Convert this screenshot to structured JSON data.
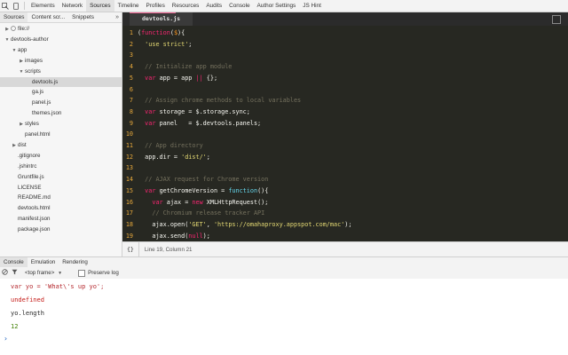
{
  "toolbar": {
    "tabs": [
      "Elements",
      "Network",
      "Sources",
      "Timeline",
      "Profiles",
      "Resources",
      "Audits",
      "Console",
      "Author Settings",
      "JS Hint"
    ],
    "active_tab": "Sources"
  },
  "navigator": {
    "tabs": [
      "Sources",
      "Content scr...",
      "Snippets"
    ],
    "more": "»",
    "tree": [
      {
        "label": "file://",
        "depth": 0,
        "arrow": "▶"
      },
      {
        "label": "devtools-author",
        "depth": 0,
        "arrow": "▼"
      },
      {
        "label": "app",
        "depth": 1,
        "arrow": "▼"
      },
      {
        "label": "images",
        "depth": 2,
        "arrow": "▶"
      },
      {
        "label": "scripts",
        "depth": 2,
        "arrow": "▼"
      },
      {
        "label": "devtools.js",
        "depth": 3,
        "arrow": "",
        "selected": true
      },
      {
        "label": "ga.js",
        "depth": 3,
        "arrow": ""
      },
      {
        "label": "panel.js",
        "depth": 3,
        "arrow": ""
      },
      {
        "label": "themes.json",
        "depth": 3,
        "arrow": ""
      },
      {
        "label": "styles",
        "depth": 2,
        "arrow": "▶"
      },
      {
        "label": "panel.html",
        "depth": 2,
        "arrow": ""
      },
      {
        "label": "dist",
        "depth": 1,
        "arrow": "▶"
      },
      {
        "label": ".gitignore",
        "depth": 1,
        "arrow": ""
      },
      {
        "label": ".jshintrc",
        "depth": 1,
        "arrow": ""
      },
      {
        "label": "Gruntfile.js",
        "depth": 1,
        "arrow": ""
      },
      {
        "label": "LICENSE",
        "depth": 1,
        "arrow": ""
      },
      {
        "label": "README.md",
        "depth": 1,
        "arrow": ""
      },
      {
        "label": "devtools.html",
        "depth": 1,
        "arrow": ""
      },
      {
        "label": "manifest.json",
        "depth": 1,
        "arrow": ""
      },
      {
        "label": "package.json",
        "depth": 1,
        "arrow": ""
      }
    ]
  },
  "editor": {
    "file_tab": "devtools.js",
    "lines": [
      {
        "n": "1",
        "tokens": [
          [
            "punc",
            "("
          ],
          [
            "keyword",
            "function"
          ],
          [
            "punc",
            "("
          ],
          [
            "param",
            "$"
          ],
          [
            "punc",
            "){"
          ]
        ]
      },
      {
        "n": "2",
        "tokens": [
          [
            "string",
            "  'use strict'"
          ],
          [
            "punc",
            ";"
          ]
        ]
      },
      {
        "n": "3",
        "tokens": []
      },
      {
        "n": "4",
        "tokens": [
          [
            "comment",
            "  // Initialize app module"
          ]
        ]
      },
      {
        "n": "5",
        "tokens": [
          [
            "keyword",
            "  var "
          ],
          [
            "plain",
            "app = app "
          ],
          [
            "keyword",
            "||"
          ],
          [
            "plain",
            " {};"
          ]
        ]
      },
      {
        "n": "6",
        "tokens": []
      },
      {
        "n": "7",
        "tokens": [
          [
            "comment",
            "  // Assign chrome methods to local variables"
          ]
        ]
      },
      {
        "n": "8",
        "tokens": [
          [
            "keyword",
            "  var "
          ],
          [
            "plain",
            "storage = $.storage.sync;"
          ]
        ]
      },
      {
        "n": "9",
        "tokens": [
          [
            "keyword",
            "  var "
          ],
          [
            "plain",
            "panel   = $.devtools.panels;"
          ]
        ]
      },
      {
        "n": "10",
        "tokens": []
      },
      {
        "n": "11",
        "tokens": [
          [
            "comment",
            "  // App directory"
          ]
        ]
      },
      {
        "n": "12",
        "tokens": [
          [
            "plain",
            "  app.dir = "
          ],
          [
            "string",
            "'dist/'"
          ],
          [
            "plain",
            ";"
          ]
        ]
      },
      {
        "n": "13",
        "tokens": []
      },
      {
        "n": "14",
        "tokens": [
          [
            "comment",
            "  // AJAX request for Chrome version"
          ]
        ]
      },
      {
        "n": "15",
        "tokens": [
          [
            "keyword",
            "  var "
          ],
          [
            "plain",
            "getChromeVersion = "
          ],
          [
            "func",
            "function"
          ],
          [
            "plain",
            "(){"
          ]
        ]
      },
      {
        "n": "16",
        "tokens": [
          [
            "keyword",
            "    var "
          ],
          [
            "plain",
            "ajax = "
          ],
          [
            "keyword",
            "new "
          ],
          [
            "plain",
            "XMLHttpRequest();"
          ]
        ]
      },
      {
        "n": "17",
        "tokens": [
          [
            "comment",
            "    // Chromium release tracker API"
          ]
        ]
      },
      {
        "n": "18",
        "tokens": [
          [
            "plain",
            "    ajax.open("
          ],
          [
            "string",
            "'GET'"
          ],
          [
            "plain",
            ", "
          ],
          [
            "string",
            "'https://omahaproxy.appspot.com/mac'"
          ],
          [
            "plain",
            ");"
          ]
        ]
      },
      {
        "n": "19",
        "tokens": [
          [
            "plain",
            "    ajax.send("
          ],
          [
            "keyword",
            "null"
          ],
          [
            "plain",
            ");"
          ]
        ]
      }
    ]
  },
  "status": {
    "braces": "{}",
    "position": "Line 19, Column 21"
  },
  "drawer": {
    "tabs": [
      "Console",
      "Emulation",
      "Rendering"
    ],
    "frame": "<top frame>",
    "frame_arrow": "▼",
    "preserve_log": "Preserve log"
  },
  "console": {
    "lines": [
      {
        "text": "var yo = 'What\\'s up yo';",
        "kind": "input"
      },
      {
        "text": "undefined",
        "kind": "result-undef"
      },
      {
        "text": "yo.length",
        "kind": "input2"
      },
      {
        "text": "12",
        "kind": "result-num"
      }
    ],
    "prompt": "›"
  },
  "colors": {
    "editor_bg": "#272822",
    "line_number": "#e6a83b",
    "keyword": "#f92672",
    "string": "#e6db74",
    "comment": "#75715e",
    "accent_tab": "#f06292"
  }
}
